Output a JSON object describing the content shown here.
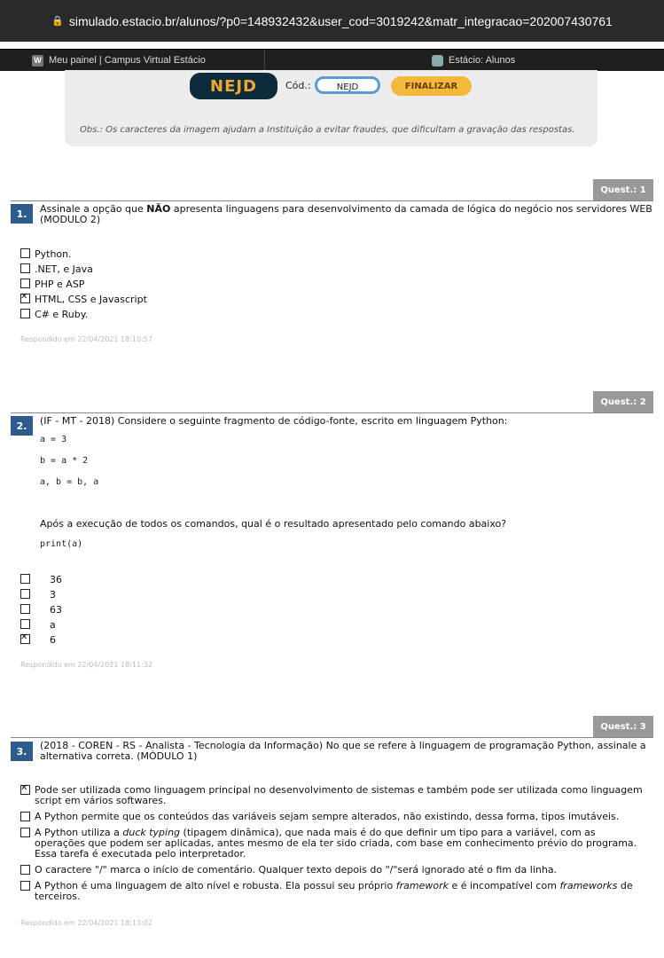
{
  "browser": {
    "url": "simulado.estacio.br/alunos/?p0=148932432&user_cod=3019242&matr_integracao=202007430761",
    "tabs": [
      {
        "label": "Meu painel | Campus Virtual Estácio",
        "favicon": "W"
      },
      {
        "label": "Estácio: Alunos"
      }
    ]
  },
  "header": {
    "captcha": "NEJD",
    "cod_label": "Cód.:",
    "cod_value": "NEJD",
    "finalizar": "FINALIZAR",
    "obs": "Obs.: Os caracteres da imagem ajudam a Instituição a evitar fraudes, que dificultam a gravação das respostas."
  },
  "questions": [
    {
      "tag": "Quest.: 1",
      "number": "1.",
      "text_pre": "Assinale a opção que ",
      "text_bold": "NÃO",
      "text_post": " apresenta linguagens para desenvolvimento da camada de lógica do negócio nos servidores WEB (MODULO 2)",
      "options": [
        {
          "label": "Python.",
          "checked": false
        },
        {
          "label": ".NET, e Java",
          "checked": false
        },
        {
          "label": "PHP e  ASP",
          "checked": false
        },
        {
          "label": "HTML, CSS e Javascript",
          "checked": true
        },
        {
          "label": "C# e Ruby.",
          "checked": false
        }
      ],
      "answered": "Respondido em 22/04/2021 18:10:57"
    },
    {
      "tag": "Quest.: 2",
      "number": "2.",
      "text": "(IF - MT - 2018) Considere o seguinte fragmento de código-fonte, escrito em linguagem Python:",
      "code": [
        "a = 3",
        "b = a * 2",
        "a, b = b, a"
      ],
      "text2": "Após a execução de todos os comandos, qual é o resultado apresentado pelo comando abaixo?",
      "code2": "print(a)",
      "options": [
        {
          "label": "36",
          "checked": false
        },
        {
          "label": "3",
          "checked": false
        },
        {
          "label": "63",
          "checked": false
        },
        {
          "label": "a",
          "checked": false
        },
        {
          "label": "6",
          "checked": true
        }
      ],
      "answered": "Respondido em 22/04/2021 18:11:32"
    },
    {
      "tag": "Quest.: 3",
      "number": "3.",
      "text": "(2018 - COREN - RS - Analista - Tecnologia da Informação) No que se refere à linguagem de programação Python, assinale a alternativa correta. (MÓDULO 1)",
      "options": [
        {
          "label": "Pode ser utilizada como linguagem principal no desenvolvimento de sistemas e também pode ser utilizada como linguagem script em vários softwares.",
          "checked": true
        },
        {
          "label": "A Python permite que os conteúdos das variáveis sejam sempre alterados, não existindo, dessa forma, tipos imutáveis.",
          "checked": false
        },
        {
          "label_pre": "A Python utiliza a ",
          "label_em": "duck typing",
          "label_post": " (tipagem dinâmica), que nada mais é do que definir um tipo para a variável, com as operações que podem ser aplicadas, antes mesmo de ela ter sido criada, com base em conhecimento prévio do programa. Essa tarefa é executada pelo interpretador.",
          "checked": false
        },
        {
          "label": "O caractere \"/\" marca o início de comentário. Qualquer texto depois do \"/\"será ignorado até o fim da linha.",
          "checked": false
        },
        {
          "label_pre": "A Python é uma linguagem de alto nível e robusta. Ela possui seu próprio ",
          "label_em": "framework",
          "label_mid": " e é incompatível com ",
          "label_em2": "frameworks",
          "label_post": " de terceiros.",
          "checked": false
        }
      ],
      "answered": "Respondido em 22/04/2021 18:13:02"
    }
  ]
}
